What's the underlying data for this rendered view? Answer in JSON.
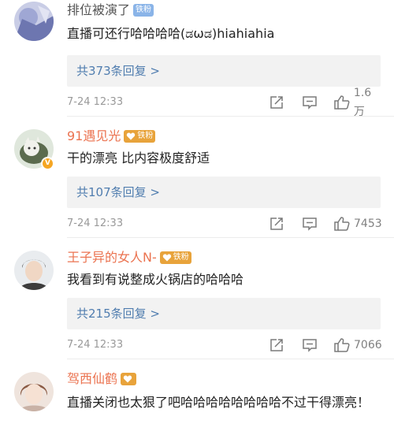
{
  "comments": [
    {
      "username": "排位被演了",
      "badge": "铁粉",
      "text": "直播可还行哈哈哈哈(ಡωಡ)hiahiahia",
      "replies": "共373条回复 >",
      "time": "7-24 12:33",
      "likes": "1.6万"
    },
    {
      "username": "91遇见光",
      "badge": "铁粉",
      "text": "干的漂亮 比内容极度舒适",
      "replies": "共107条回复 >",
      "time": "7-24 12:33",
      "likes": "7453"
    },
    {
      "username": "王子异的女人N-",
      "badge": "铁粉",
      "text": "我看到有说整成火锅店的哈哈哈",
      "replies": "共215条回复 >",
      "time": "7-24 12:33",
      "likes": "7066"
    },
    {
      "username": "驾西仙鹤",
      "badge": "",
      "text": "直播关闭也太狠了吧哈哈哈哈哈哈哈哈不过干得漂亮！",
      "replies": "",
      "time": "",
      "likes": ""
    }
  ],
  "colors": {
    "link": "#507daf",
    "username_highlight": "#eb7350",
    "badge_blue": "#8ab4e8",
    "badge_gold": "#e8a33b",
    "verified": "#f5a623"
  }
}
